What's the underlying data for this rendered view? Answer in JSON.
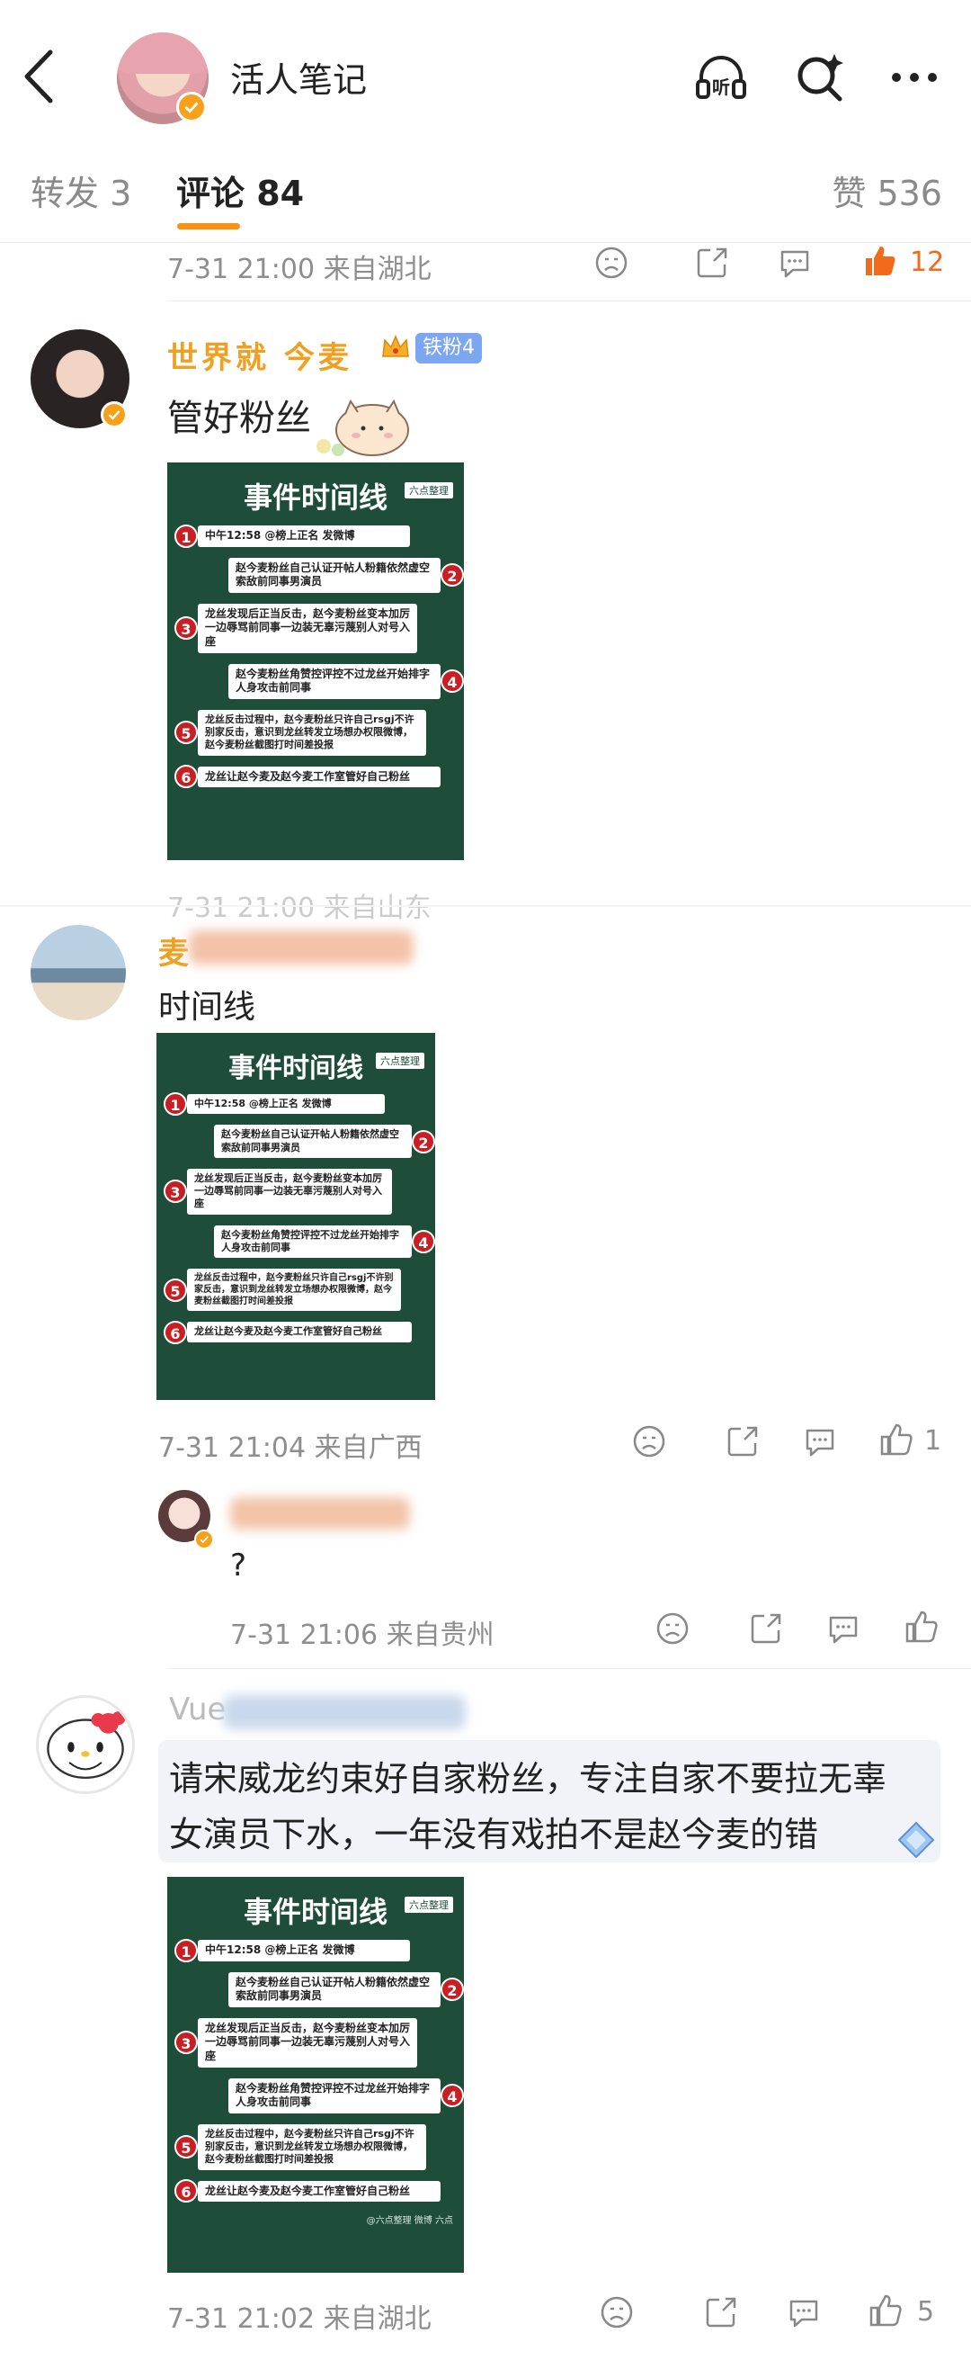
{
  "header": {
    "title": "活人笔记",
    "listen_icon": "listen-icon",
    "search_icon": "search-icon",
    "more_icon": "more-icon"
  },
  "tabs": {
    "repost": "转发 3",
    "comments": "评论 84",
    "likes": "赞 536"
  },
  "comments": [
    {
      "meta": "7-31 21:00  来自湖北",
      "like_count": "12"
    },
    {
      "user": "世界就   今麦",
      "fan_badge": "铁粉4",
      "text": "管好粉丝",
      "meta": "7-31 21:00  来自山东"
    },
    {
      "user": "麦",
      "text": "时间线",
      "meta": "7-31 21:04  来自广西",
      "like_count": "1",
      "reply": {
        "text": "?",
        "meta": "7-31 21:06  来自贵州"
      }
    },
    {
      "user": "Vue",
      "text_line1": "请宋威龙约束好自家粉丝，专注自家不要拉无辜",
      "text_line2": "女演员下水，一年没有戏拍不是赵今麦的错",
      "meta": "7-31 21:02  来自湖北",
      "like_count": "5"
    }
  ],
  "timeline": {
    "title": "事件时间线",
    "tag": "六点整理",
    "items": [
      {
        "num": "1",
        "text": "中午12:58 @榜上正名 发微博"
      },
      {
        "num": "2",
        "text": "赵今麦粉丝自己认证开帖人粉籍依然虚空索敌前同事男演员"
      },
      {
        "num": "3",
        "text": "龙丝发现后正当反击，赵今麦粉丝变本加厉一边辱骂前同事一边装无辜污蔑别人对号入座"
      },
      {
        "num": "4",
        "text": "赵今麦粉丝角赞控评控不过龙丝开始排字人身攻击前同事"
      },
      {
        "num": "5",
        "text": "龙丝反击过程中，赵今麦粉丝只许自己rsgj不许别家反击，意识到龙丝转发立场想办权限微博，赵今麦粉丝截图打时间差投报"
      },
      {
        "num": "6",
        "text": "龙丝让赵今麦及赵今麦工作室管好自己粉丝"
      }
    ],
    "credit": "@六点整理 微博 六点"
  },
  "colors": {
    "accent": "#f79212",
    "like_hot": "#f26b1d",
    "card_green": "#1e4d3a",
    "number_red": "#c91f24",
    "fan_badge": "#7ca6f0"
  }
}
